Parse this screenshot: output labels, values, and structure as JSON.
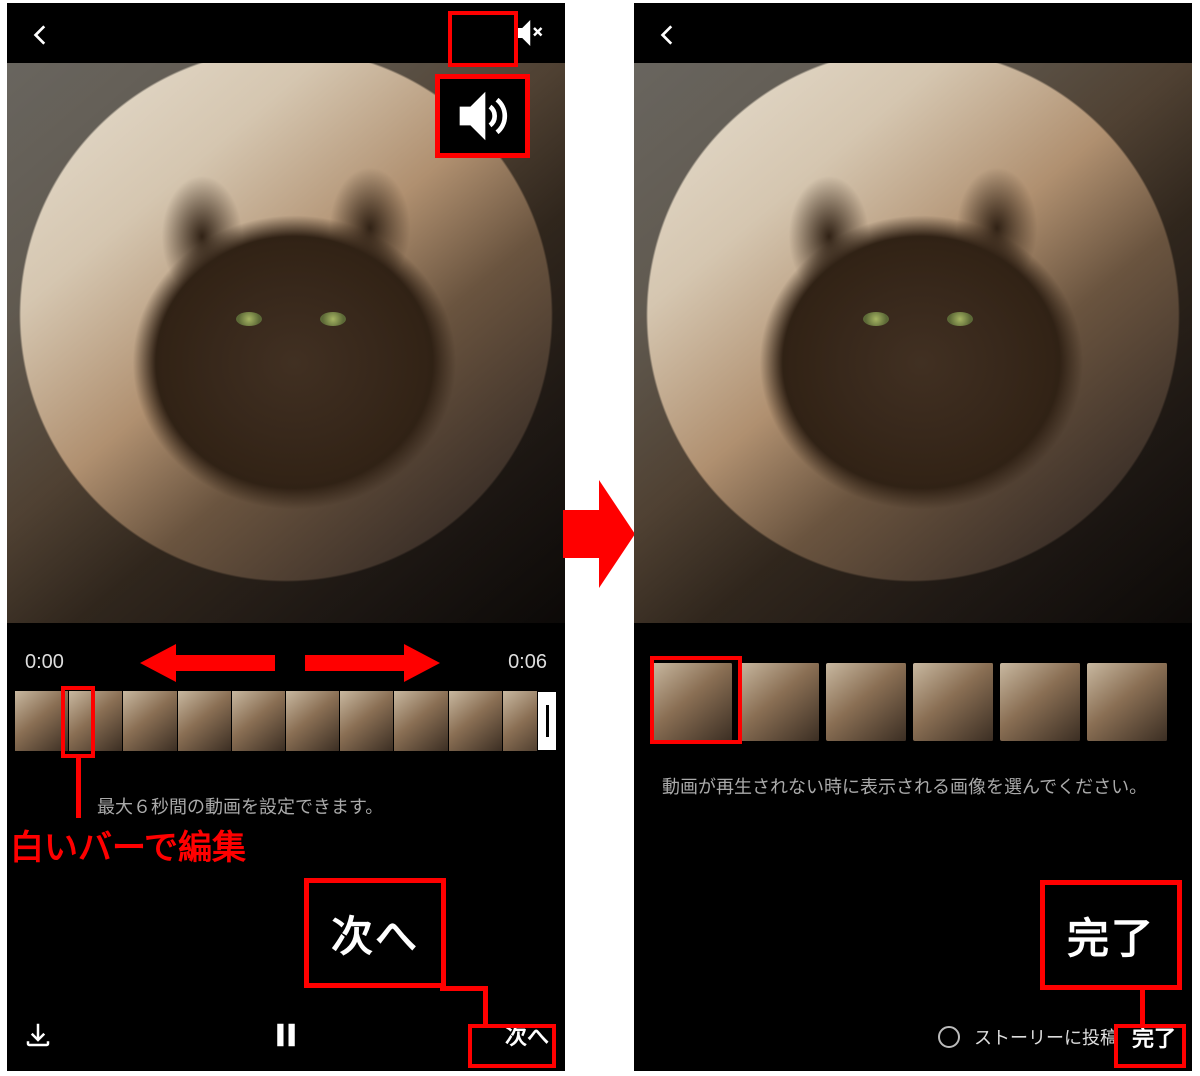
{
  "accent_red": "#ff0000",
  "left": {
    "time_start": "0:00",
    "time_end": "0:06",
    "hint": "最大６秒間の動画を設定できます。",
    "next_label": "次へ",
    "callout_next": "次へ",
    "callout_bar": "白いバーで編集",
    "sound_state": "muted"
  },
  "right": {
    "hint": "動画が再生されない時に表示される画像を選んでください。",
    "story_label": "ストーリーに投稿",
    "done_label": "完了",
    "callout_done": "完了",
    "frame_count": 6
  },
  "icons": {
    "back": "chevron-left",
    "mute": "speaker-mute",
    "sound": "speaker-on",
    "download": "download",
    "pause": "pause"
  }
}
